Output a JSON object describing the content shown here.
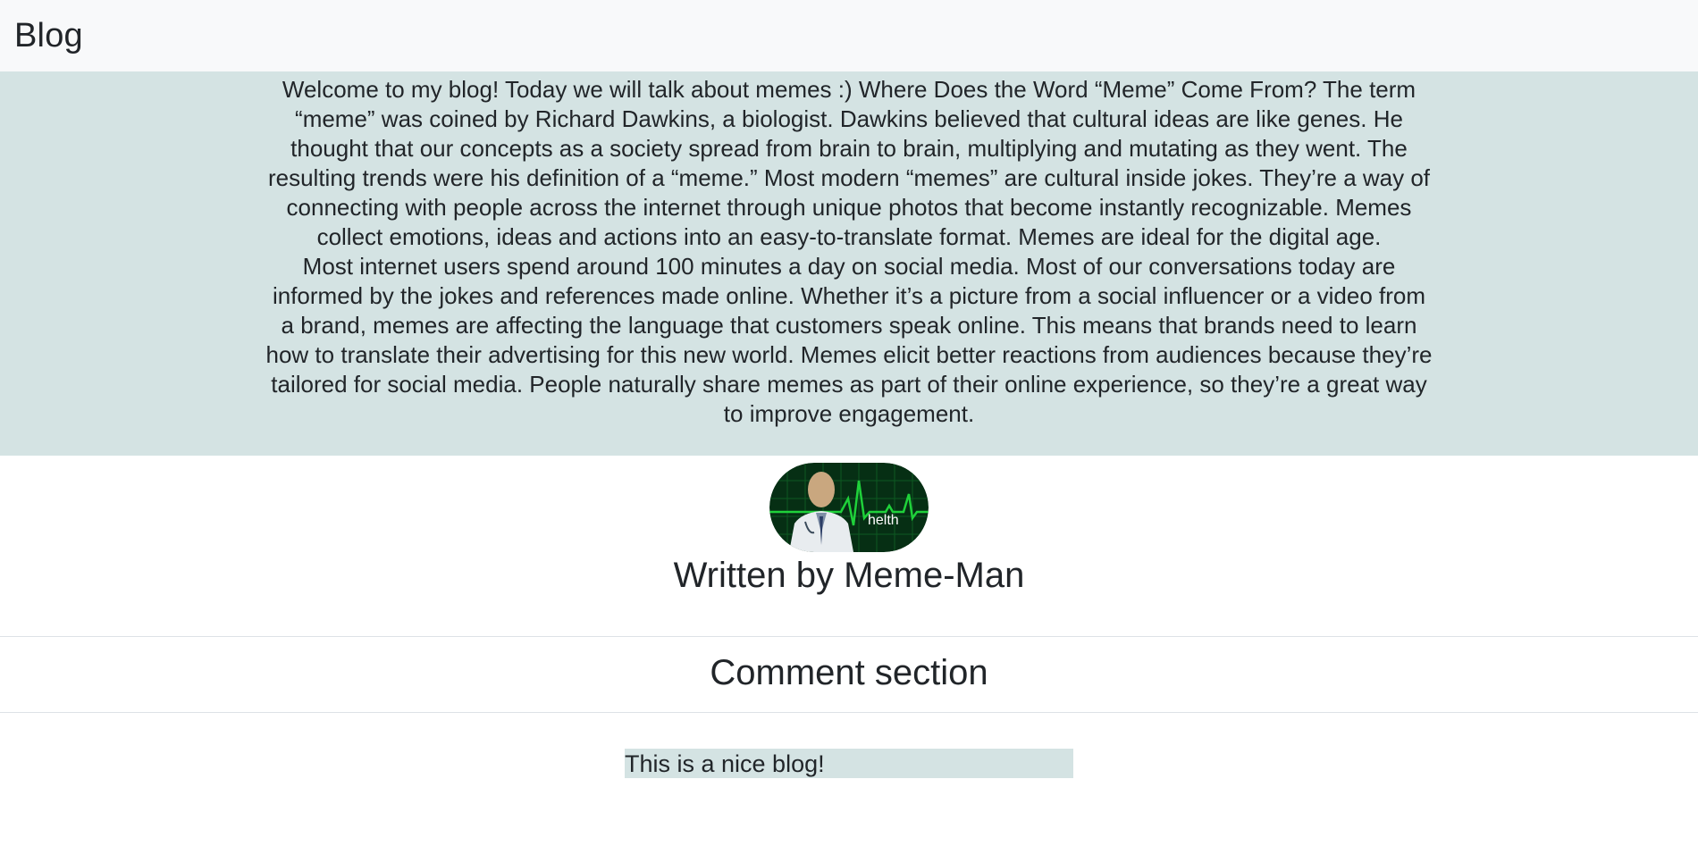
{
  "navbar": {
    "brand": "Blog"
  },
  "article": {
    "paragraphs": [
      "Welcome to my blog! Today we will talk about memes :) Where Does the Word “Meme” Come From? The term “meme” was coined by Richard Dawkins, a biologist. Dawkins believed that cultural ideas are like genes. He thought that our concepts as a society spread from brain to brain, multiplying and mutating as they went. The resulting trends were his definition of a “meme.” Most modern “memes” are cultural inside jokes. They’re a way of connecting with people across the internet through unique photos that become instantly recognizable. Memes collect emotions, ideas and actions into an easy-to-translate format. Memes are ideal for the digital age.",
      "Most internet users spend around 100 minutes a day on social media. Most of our conversations today are informed by the jokes and references made online. Whether it’s a picture from a social influencer or a video from a brand, memes are affecting the language that customers speak online. This means that brands need to learn how to translate their advertising for this new world. Memes elicit better reactions from audiences because they’re tailored for social media. People naturally share memes as part of their online experience, so they’re a great way to improve engagement."
    ]
  },
  "author": {
    "avatar_caption": "helth",
    "name": "Written by Meme-Man"
  },
  "comments": {
    "title": "Comment section",
    "items": [
      {
        "text": "This is a nice blog!"
      }
    ]
  },
  "colors": {
    "navbar_bg": "#f8f9fa",
    "article_bg": "#d4e3e3",
    "comment_bg": "#d4e3e3",
    "text": "#212529",
    "monitor_green": "#1fd13a"
  }
}
